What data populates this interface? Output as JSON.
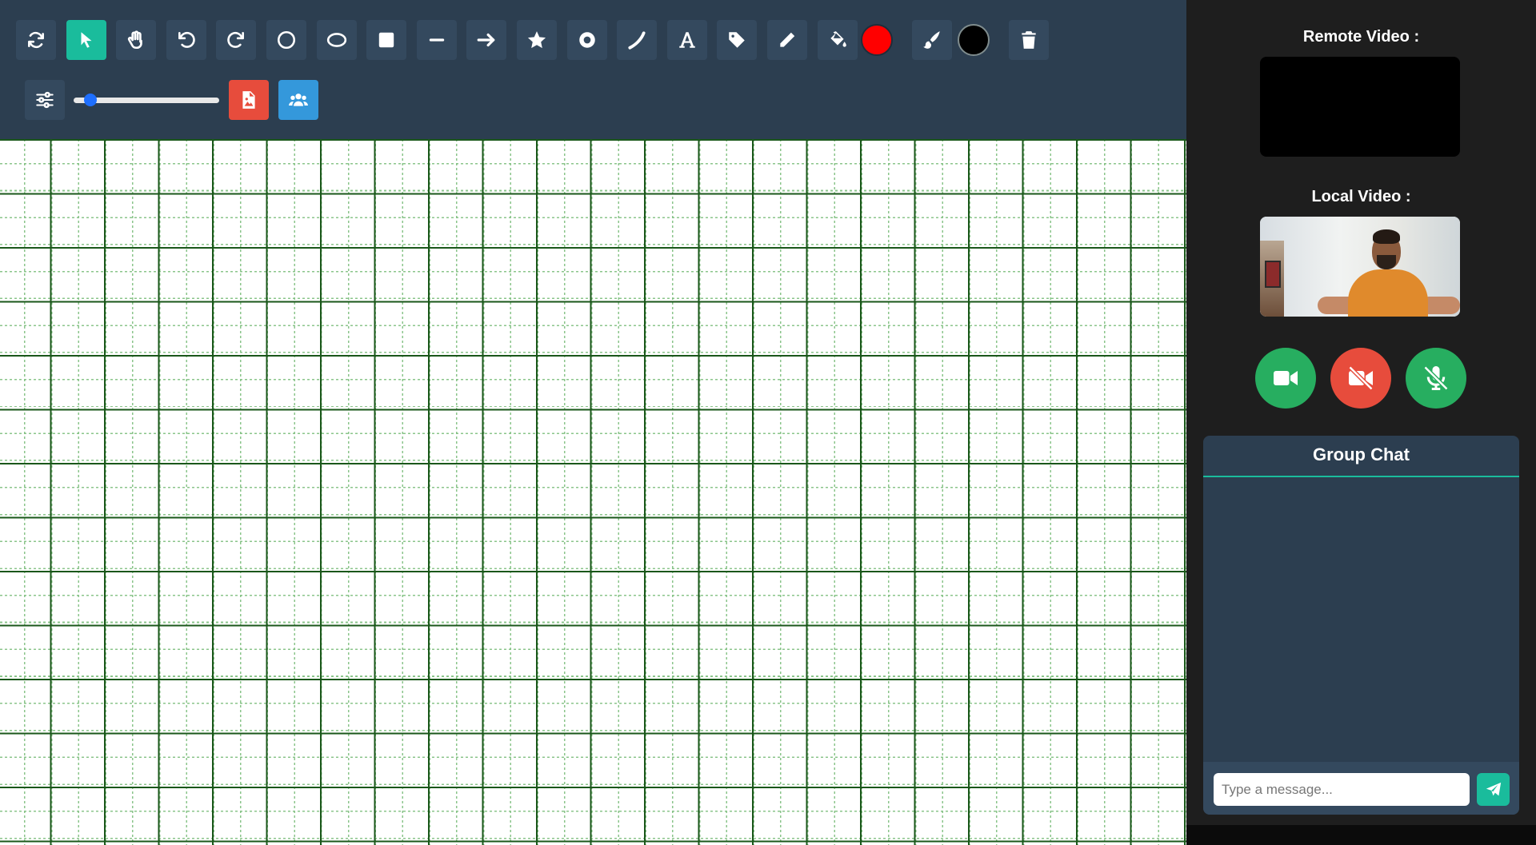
{
  "toolbar": {
    "tools": [
      {
        "name": "refresh-icon",
        "active": false
      },
      {
        "name": "select-pointer-icon",
        "active": true
      },
      {
        "name": "pan-hand-icon",
        "active": false
      },
      {
        "name": "undo-icon",
        "active": false
      },
      {
        "name": "redo-icon",
        "active": false
      },
      {
        "name": "circle-icon",
        "active": false
      },
      {
        "name": "ellipse-icon",
        "active": false
      },
      {
        "name": "square-icon",
        "active": false
      },
      {
        "name": "line-icon",
        "active": false
      },
      {
        "name": "arrow-right-icon",
        "active": false
      },
      {
        "name": "star-icon",
        "active": false
      },
      {
        "name": "dot-circle-icon",
        "active": false
      },
      {
        "name": "curve-icon",
        "active": false
      },
      {
        "name": "text-icon",
        "active": false
      },
      {
        "name": "tag-icon",
        "active": false
      },
      {
        "name": "pencil-icon",
        "active": false
      },
      {
        "name": "fill-bucket-icon",
        "active": false
      }
    ],
    "fill_color": "#ff0000",
    "stroke_color": "#000000",
    "accent_active": "#1abc9c",
    "brush_size_fraction": 0.06,
    "row2_icons": [
      "sliders-icon",
      "image-icon",
      "users-icon"
    ]
  },
  "canvas": {
    "grid": "graph-paper",
    "major_line_color": "#1a571a",
    "minor_line_color": "#7fbf7f"
  },
  "side": {
    "remote_label": "Remote Video :",
    "local_label": "Local Video :",
    "call_controls": [
      {
        "name": "video-camera-icon",
        "color": "#27ae60"
      },
      {
        "name": "video-camera-off-icon",
        "color": "#e74c3c"
      },
      {
        "name": "microphone-off-icon",
        "color": "#27ae60"
      }
    ]
  },
  "chat": {
    "title": "Group Chat",
    "placeholder": "Type a message...",
    "send_icon": "paper-plane-icon"
  }
}
